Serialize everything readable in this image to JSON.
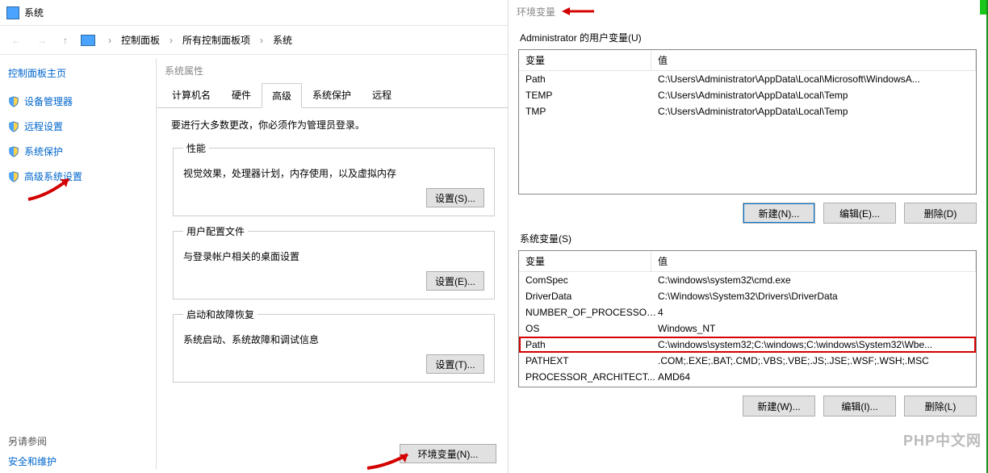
{
  "system_window": {
    "title": "系统",
    "nav": {
      "back": "←",
      "fwd": "→",
      "up": "↑"
    },
    "breadcrumb": [
      "控制面板",
      "所有控制面板项",
      "系统"
    ],
    "sidenav": {
      "home": "控制面板主页",
      "items": [
        {
          "label": "设备管理器"
        },
        {
          "label": "远程设置"
        },
        {
          "label": "系统保护"
        },
        {
          "label": "高级系统设置"
        }
      ],
      "see_also_label": "另请参阅",
      "see_also_link": "安全和维护"
    }
  },
  "props_dialog": {
    "title": "系统属性",
    "tabs": {
      "computer_name": "计算机名",
      "hardware": "硬件",
      "advanced": "高级",
      "protection": "系统保护",
      "remote": "远程"
    },
    "note": "要进行大多数更改，你必须作为管理员登录。",
    "perf": {
      "legend": "性能",
      "desc": "视觉效果，处理器计划，内存使用，以及虚拟内存",
      "button": "设置(S)..."
    },
    "profile": {
      "legend": "用户配置文件",
      "desc": "与登录帐户相关的桌面设置",
      "button": "设置(E)..."
    },
    "startup": {
      "legend": "启动和故障恢复",
      "desc": "系统启动、系统故障和调试信息",
      "button": "设置(T)..."
    },
    "env_button": "环境变量(N)..."
  },
  "env_dialog": {
    "title": "环境变量",
    "user_vars_label": "Administrator 的用户变量(U)",
    "sys_vars_label": "系统变量(S)",
    "headers": {
      "var": "变量",
      "val": "值"
    },
    "user_vars": [
      {
        "name": "Path",
        "value": "C:\\Users\\Administrator\\AppData\\Local\\Microsoft\\WindowsA..."
      },
      {
        "name": "TEMP",
        "value": "C:\\Users\\Administrator\\AppData\\Local\\Temp"
      },
      {
        "name": "TMP",
        "value": "C:\\Users\\Administrator\\AppData\\Local\\Temp"
      }
    ],
    "sys_vars": [
      {
        "name": "ComSpec",
        "value": "C:\\windows\\system32\\cmd.exe"
      },
      {
        "name": "DriverData",
        "value": "C:\\Windows\\System32\\Drivers\\DriverData"
      },
      {
        "name": "NUMBER_OF_PROCESSORS",
        "value": "4"
      },
      {
        "name": "OS",
        "value": "Windows_NT"
      },
      {
        "name": "Path",
        "value": "C:\\windows\\system32;C:\\windows;C:\\windows\\System32\\Wbe..."
      },
      {
        "name": "PATHEXT",
        "value": ".COM;.EXE;.BAT;.CMD;.VBS;.VBE;.JS;.JSE;.WSF;.WSH;.MSC"
      },
      {
        "name": "PROCESSOR_ARCHITECT...",
        "value": "AMD64"
      }
    ],
    "buttons": {
      "new_user": "新建(N)...",
      "edit_user": "编辑(E)...",
      "del_user": "删除(D)",
      "new_sys": "新建(W)...",
      "edit_sys": "编辑(I)...",
      "del_sys": "删除(L)"
    }
  },
  "watermark": "PHP中文网"
}
